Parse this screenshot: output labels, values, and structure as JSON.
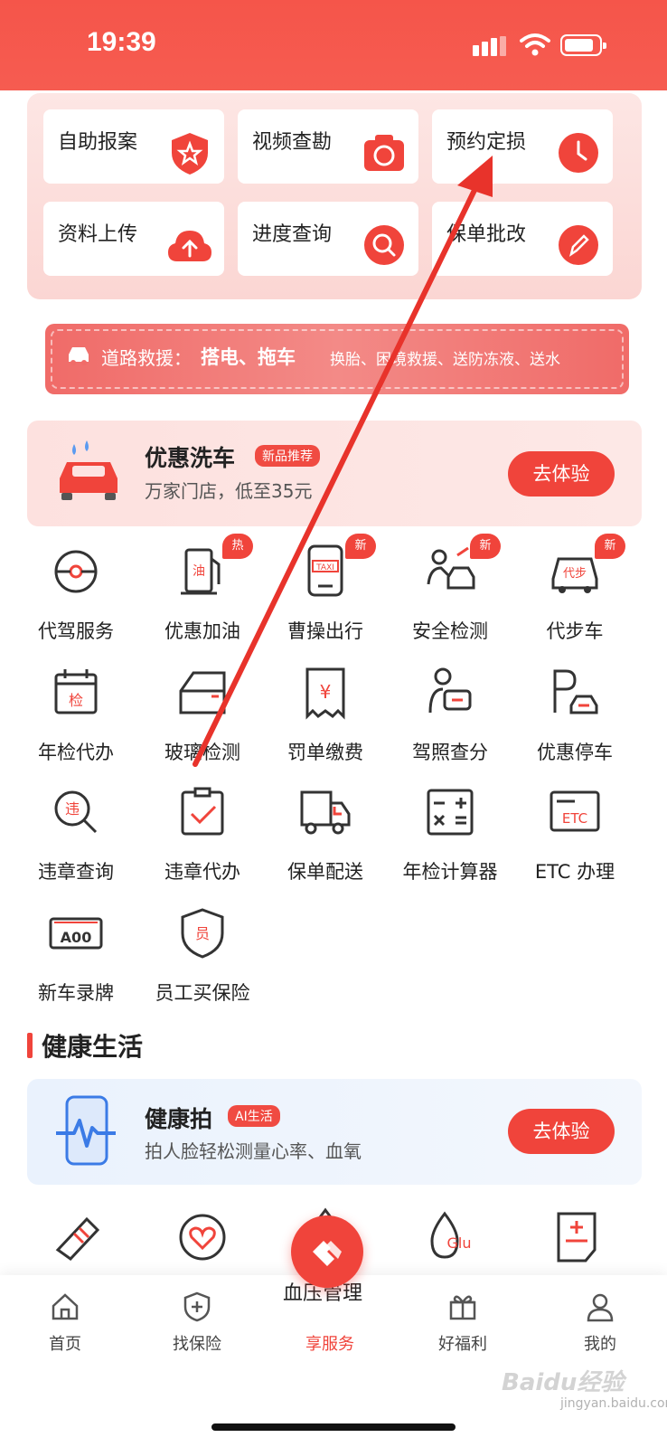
{
  "status_bar": {
    "time": "19:39"
  },
  "quick_actions": [
    {
      "label": "自助报案",
      "icon": "shield-star-icon"
    },
    {
      "label": "视频查勘",
      "icon": "camera-icon"
    },
    {
      "label": "预约定损",
      "icon": "clock-icon"
    },
    {
      "label": "资料上传",
      "icon": "cloud-upload-icon"
    },
    {
      "label": "进度查询",
      "icon": "search-icon"
    },
    {
      "label": "保单批改",
      "icon": "pencil-icon"
    }
  ],
  "rescue_banner": {
    "title": "道路救援：",
    "highlight": "搭电、拖车",
    "rest": "换胎、困境救援、送防冻液、送水"
  },
  "car_wash": {
    "title": "优惠洗车",
    "badge": "新品推荐",
    "subtitle": "万家门店，低至35元",
    "cta": "去体验"
  },
  "services": [
    {
      "label": "代驾服务",
      "icon": "steering-wheel-icon",
      "tag": ""
    },
    {
      "label": "优惠加油",
      "icon": "fuel-pump-icon",
      "tag": "热"
    },
    {
      "label": "曹操出行",
      "icon": "taxi-icon",
      "tag": "新"
    },
    {
      "label": "安全检测",
      "icon": "car-inspection-icon",
      "tag": "新"
    },
    {
      "label": "代步车",
      "icon": "replacement-car-icon",
      "tag": "新"
    },
    {
      "label": "年检代办",
      "icon": "calendar-inspection-icon",
      "tag": ""
    },
    {
      "label": "玻璃检测",
      "icon": "glass-icon",
      "tag": ""
    },
    {
      "label": "罚单缴费",
      "icon": "fine-receipt-icon",
      "tag": ""
    },
    {
      "label": "驾照查分",
      "icon": "license-icon",
      "tag": ""
    },
    {
      "label": "优惠停车",
      "icon": "parking-icon",
      "tag": ""
    },
    {
      "label": "违章查询",
      "icon": "violation-search-icon",
      "tag": ""
    },
    {
      "label": "违章代办",
      "icon": "violation-check-icon",
      "tag": ""
    },
    {
      "label": "保单配送",
      "icon": "delivery-truck-icon",
      "tag": ""
    },
    {
      "label": "年检计算器",
      "icon": "calculator-icon",
      "tag": ""
    },
    {
      "label": "ETC 办理",
      "icon": "etc-card-icon",
      "tag": ""
    },
    {
      "label": "新车录牌",
      "icon": "license-plate-icon",
      "tag": ""
    },
    {
      "label": "员工买保险",
      "icon": "employee-shield-icon",
      "tag": ""
    }
  ],
  "health_section": {
    "title": "健康生活"
  },
  "health_card": {
    "title": "健康拍",
    "badge": "AI生活",
    "subtitle": "拍人脸轻松测量心率、血氧",
    "cta": "去体验"
  },
  "health_icons": [
    "shoe-icon",
    "heart-cycle-icon",
    "blood-drop-icon",
    "glucose-icon",
    "medical-record-icon"
  ],
  "overlay_label": "血压管理",
  "tabbar": [
    {
      "label": "首页",
      "icon": "home-icon",
      "active": false
    },
    {
      "label": "找保险",
      "icon": "shield-plus-icon",
      "active": false
    },
    {
      "label": "享服务",
      "icon": "handshake-icon",
      "active": true
    },
    {
      "label": "好福利",
      "icon": "gift-icon",
      "active": false
    },
    {
      "label": "我的",
      "icon": "user-icon",
      "active": false
    }
  ],
  "watermark": {
    "text": "Baidu经验",
    "sub": "jingyan.baidu.com"
  },
  "colors": {
    "primary": "#f0443b",
    "header": "#f5554a",
    "annotation_arrow": "#e8332b"
  }
}
